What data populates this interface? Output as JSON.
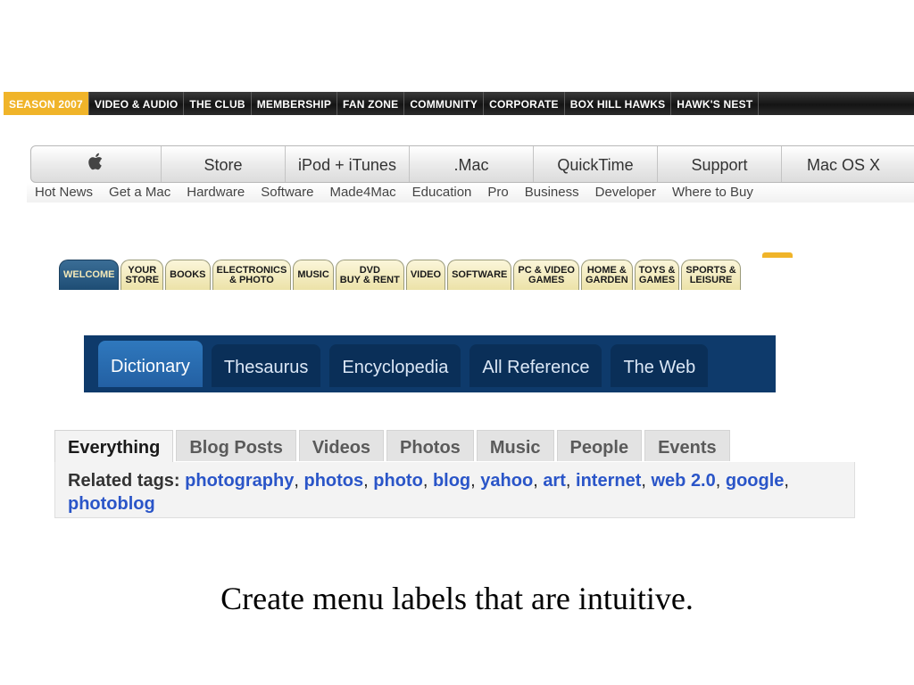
{
  "hawks_nav": {
    "items": [
      "SEASON 2007",
      "VIDEO & AUDIO",
      "THE CLUB",
      "MEMBERSHIP",
      "FAN ZONE",
      "COMMUNITY",
      "CORPORATE",
      "BOX HILL HAWKS",
      "HAWK'S NEST"
    ],
    "active_index": 0
  },
  "apple_nav": {
    "logo_icon": "apple-logo-icon",
    "tabs": [
      "Store",
      "iPod + iTunes",
      ".Mac",
      "QuickTime",
      "Support",
      "Mac OS X"
    ],
    "subnav": [
      "Hot News",
      "Get a Mac",
      "Hardware",
      "Software",
      "Made4Mac",
      "Education",
      "Pro",
      "Business",
      "Developer",
      "Where to Buy"
    ]
  },
  "amazon_nav": {
    "tabs": [
      "WELCOME",
      "YOUR\nSTORE",
      "BOOKS",
      "ELECTRONICS\n& PHOTO",
      "MUSIC",
      "DVD\nBUY & RENT",
      "VIDEO",
      "SOFTWARE",
      "PC & VIDEO\nGAMES",
      "HOME &\nGARDEN",
      "TOYS &\nGAMES",
      "SPORTS &\nLEISURE"
    ],
    "active_index": 0
  },
  "dictionary_nav": {
    "tabs": [
      "Dictionary",
      "Thesaurus",
      "Encyclopedia",
      "All Reference",
      "The Web"
    ],
    "active_index": 0
  },
  "tag_panel": {
    "tabs": [
      "Everything",
      "Blog Posts",
      "Videos",
      "Photos",
      "Music",
      "People",
      "Events"
    ],
    "active_index": 0,
    "related_label": "Related tags:",
    "tags": [
      "photography",
      "photos",
      "photo",
      "blog",
      "yahoo",
      "art",
      "internet",
      "web 2.0",
      "google",
      "photoblog"
    ]
  },
  "caption": "Create menu labels that are intuitive.",
  "colors": {
    "hawks_active": "#f0b429",
    "amazon_active": "#1e4d74",
    "dict_bar": "#0e3a6b",
    "tag_link": "#2a55c8"
  }
}
